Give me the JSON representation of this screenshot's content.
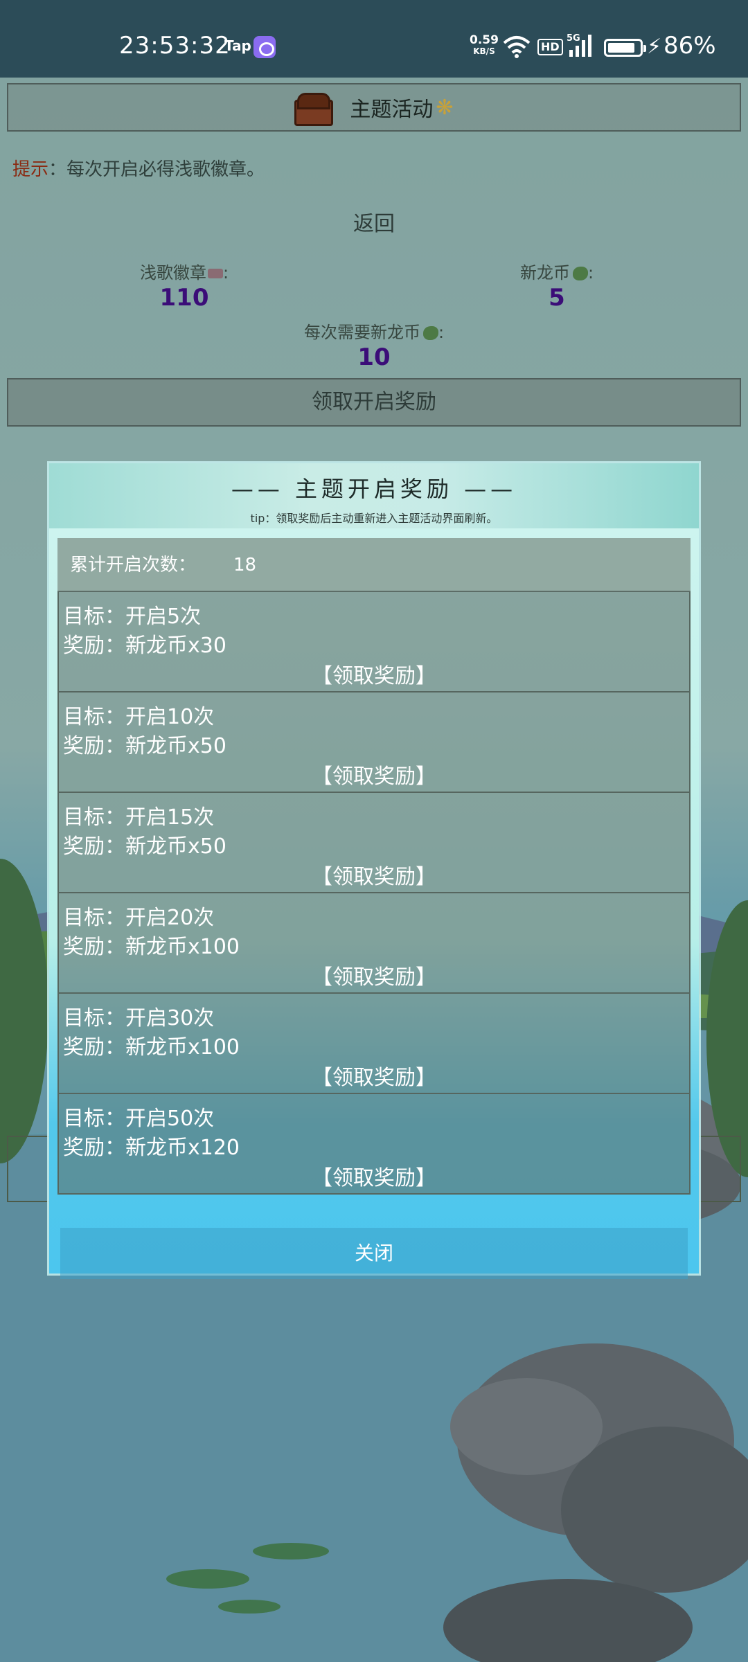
{
  "status_bar": {
    "time": "23:53:32",
    "tap_label": "Tap",
    "net_speed_value": "0.59",
    "net_speed_unit": "KB/S",
    "hd_label": "HD",
    "network_label": "5G",
    "battery_percent": "86%",
    "battery_level": 0.86
  },
  "page": {
    "title": "主题活动",
    "hint_prefix": "提示",
    "hint_text": "：每次开启必得浅歌徽章。",
    "back_label": "返回",
    "badge_label": "浅歌徽章",
    "badge_value": "110",
    "coin_label": "新龙币",
    "coin_value": "5",
    "cost_label": "每次需要新龙币",
    "cost_value": "10",
    "label_suffix": ":",
    "claim_open_label": "领取开启奖励"
  },
  "modal": {
    "title": "—— 主题开启奖励 ——",
    "tip": "tip：领取奖励后主动重新进入主题活动界面刷新。",
    "count_label": "累计开启次数：",
    "count_value": "18",
    "goals": [
      {
        "target": "目标：开启5次",
        "reward": "奖励：新龙币x30",
        "claim": "【领取奖励】"
      },
      {
        "target": "目标：开启10次",
        "reward": "奖励：新龙币x50",
        "claim": "【领取奖励】"
      },
      {
        "target": "目标：开启15次",
        "reward": "奖励：新龙币x50",
        "claim": "【领取奖励】"
      },
      {
        "target": "目标：开启20次",
        "reward": "奖励：新龙币x100",
        "claim": "【领取奖励】"
      },
      {
        "target": "目标：开启30次",
        "reward": "奖励：新龙币x100",
        "claim": "【领取奖励】"
      },
      {
        "target": "目标：开启50次",
        "reward": "奖励：新龙币x120",
        "claim": "【领取奖励】"
      }
    ],
    "close_label": "关闭"
  },
  "colors": {
    "status_bar": "#2c4c58",
    "value_purple": "#3b0d78",
    "hint_red": "#8a2a12",
    "modal_header": "#9fdcd5"
  }
}
